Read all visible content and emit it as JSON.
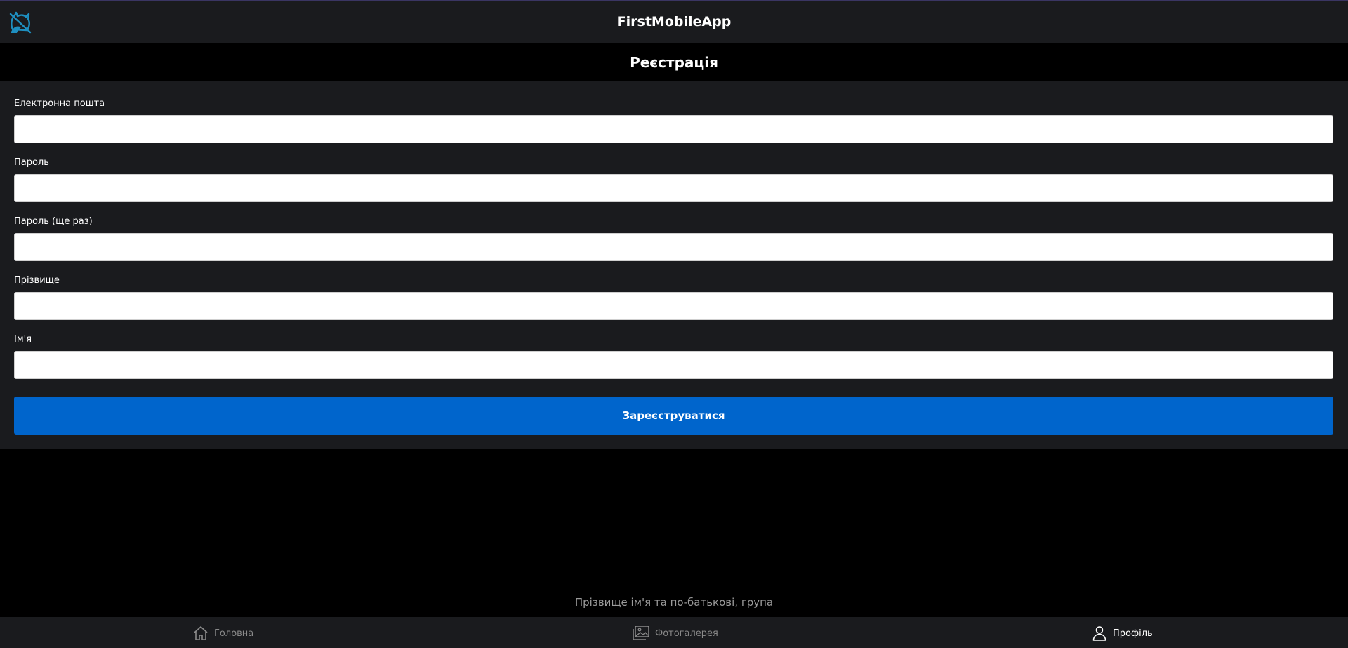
{
  "app": {
    "title": "FirstMobileApp",
    "logo_icon": "cat-silhouette-icon",
    "accent_color": "#0065cc"
  },
  "page": {
    "title": "Реєстрація"
  },
  "form": {
    "fields": [
      {
        "name": "email",
        "label": "Електронна пошта",
        "value": "",
        "placeholder": ""
      },
      {
        "name": "password",
        "label": "Пароль",
        "value": "",
        "placeholder": ""
      },
      {
        "name": "password_repeat",
        "label": "Пароль (ще раз)",
        "value": "",
        "placeholder": ""
      },
      {
        "name": "last_name",
        "label": "Прізвище",
        "value": "",
        "placeholder": ""
      },
      {
        "name": "first_name",
        "label": "Ім'я",
        "value": "",
        "placeholder": ""
      }
    ],
    "submit_label": "Зареєструватися"
  },
  "footer": {
    "text": "Прізвище ім'я та по-батькові, група"
  },
  "bottom_nav": {
    "items": [
      {
        "label": "Головна",
        "icon": "home-icon",
        "active": false
      },
      {
        "label": "Фотогалерея",
        "icon": "gallery-icon",
        "active": false
      },
      {
        "label": "Профіль",
        "icon": "user-icon",
        "active": true
      }
    ]
  }
}
